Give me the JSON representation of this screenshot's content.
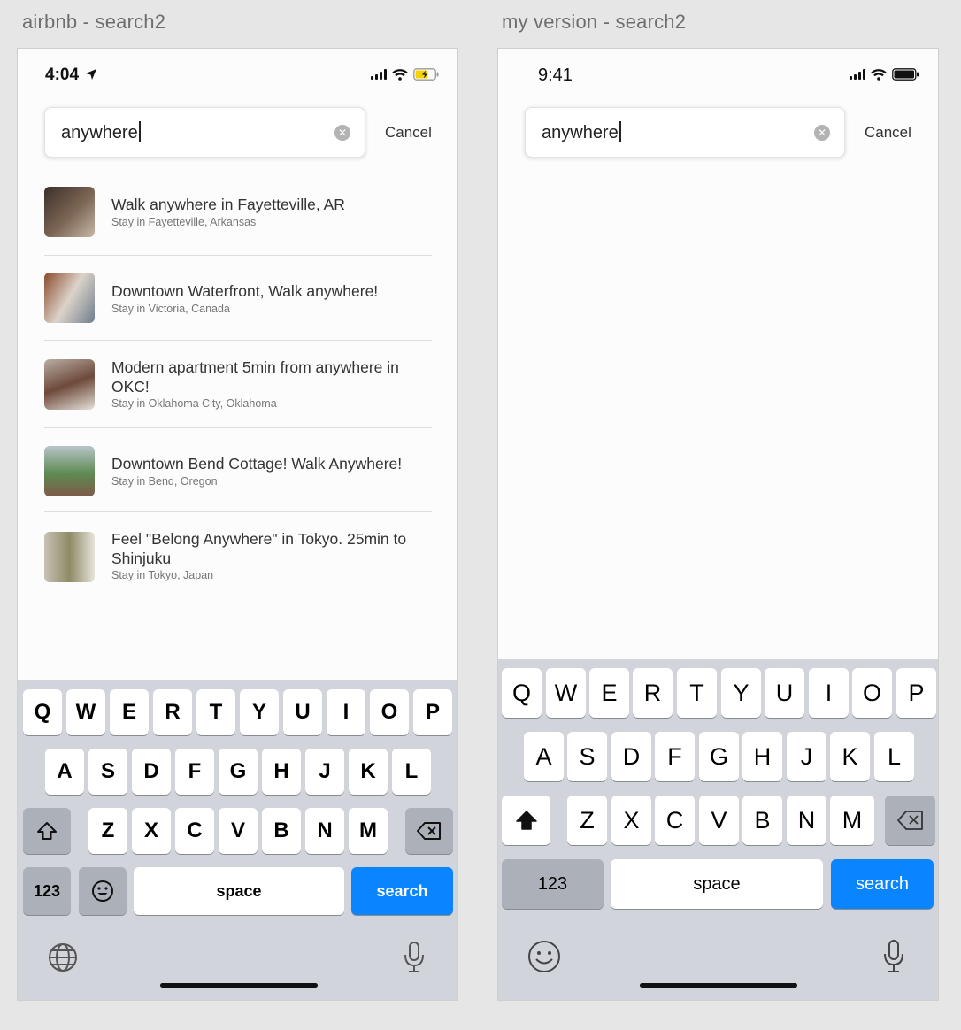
{
  "artboards": {
    "left_title": "airbnb - search2",
    "right_title": "my version - search2"
  },
  "left": {
    "status": {
      "time": "4:04",
      "battery": "charging"
    },
    "search": {
      "value": "anywhere",
      "cancel": "Cancel"
    },
    "results": [
      {
        "title": "Walk anywhere in Fayetteville, AR",
        "subtitle": "Stay in Fayetteville, Arkansas",
        "thumb_colors": [
          "#3b2f2a",
          "#7d6655",
          "#c8b8a6"
        ]
      },
      {
        "title": "Downtown Waterfront, Walk anywhere!",
        "subtitle": "Stay in Victoria, Canada",
        "thumb_colors": [
          "#8a4a2c",
          "#dcd3c9",
          "#6f7e8c"
        ]
      },
      {
        "title": "Modern apartment 5min from anywhere in OKC!",
        "subtitle": "Stay in Oklahoma City, Oklahoma",
        "thumb_colors": [
          "#b9ada3",
          "#6d4a3a",
          "#e6e1db"
        ]
      },
      {
        "title": "Downtown Bend Cottage! Walk Anywhere!",
        "subtitle": "Stay in Bend, Oregon",
        "thumb_colors": [
          "#5d8a52",
          "#b7c4c8",
          "#7e5a4a"
        ]
      },
      {
        "title": "Feel \"Belong Anywhere\" in Tokyo. 25min to Shinjuku",
        "subtitle": "Stay in Tokyo, Japan",
        "thumb_colors": [
          "#c7c2b4",
          "#8f8a66",
          "#e8e4da"
        ]
      }
    ]
  },
  "right": {
    "status": {
      "time": "9:41",
      "battery": "full"
    },
    "search": {
      "value": "anywhere",
      "cancel": "Cancel"
    }
  },
  "keyboard": {
    "row1": [
      "Q",
      "W",
      "E",
      "R",
      "T",
      "Y",
      "U",
      "I",
      "O",
      "P"
    ],
    "row2": [
      "A",
      "S",
      "D",
      "F",
      "G",
      "H",
      "J",
      "K",
      "L"
    ],
    "row3": [
      "Z",
      "X",
      "C",
      "V",
      "B",
      "N",
      "M"
    ],
    "numbers_label": "123",
    "space_label": "space",
    "search_label": "search"
  },
  "colors": {
    "search_key": "#0a84ff",
    "keyboard_bg": "#d1d4da",
    "charging_battery": "#f5d300"
  },
  "icons": [
    "location-arrow-icon",
    "signal-icon",
    "wifi-icon",
    "battery-icon",
    "clear-icon",
    "shift-icon",
    "backspace-icon",
    "emoji-icon",
    "globe-icon",
    "microphone-icon"
  ]
}
